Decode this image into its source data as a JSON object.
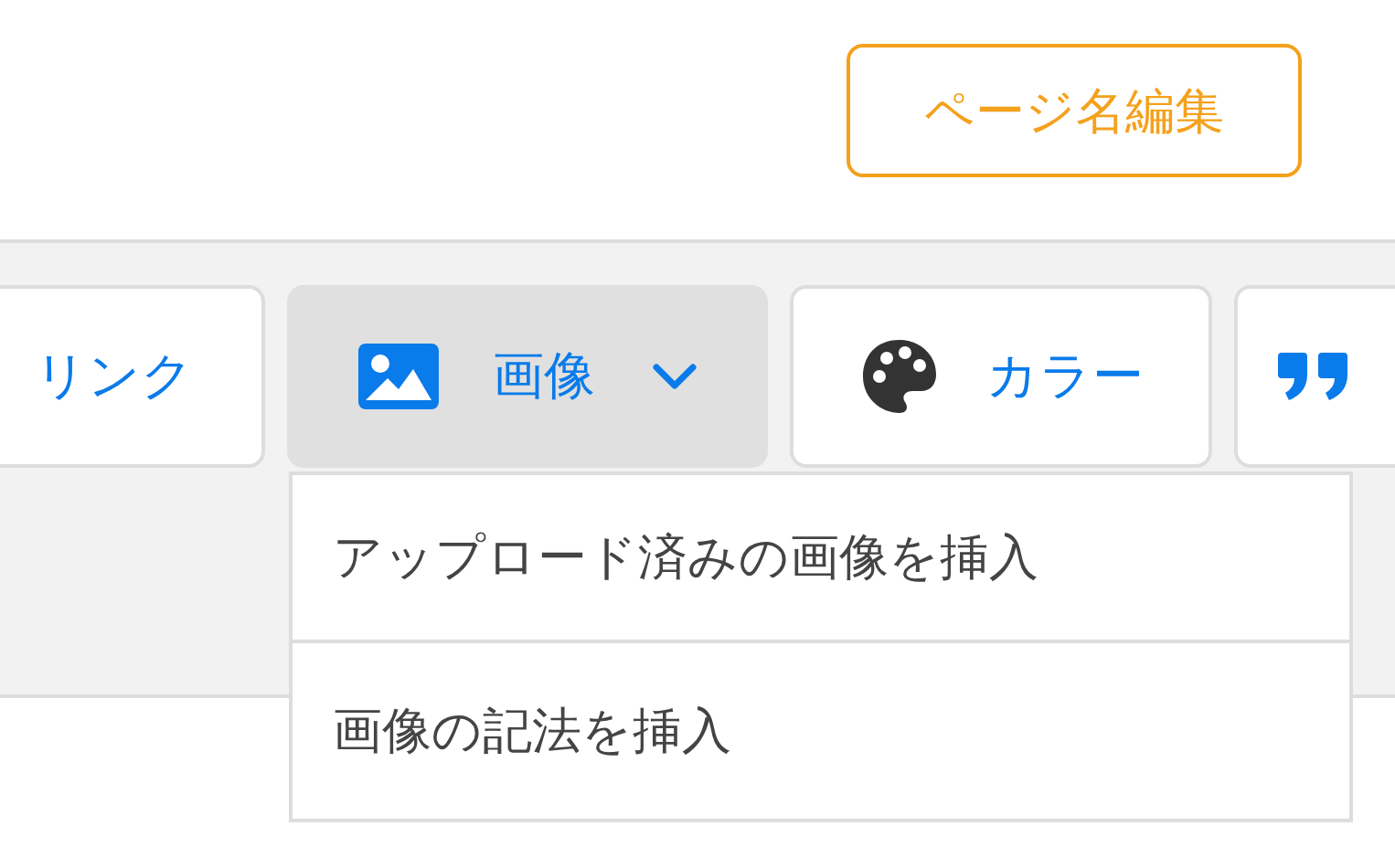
{
  "header": {
    "edit_button": "ページ名編集"
  },
  "toolbar": {
    "buttons": [
      {
        "label": "リンク",
        "kind": "text",
        "selected": false
      },
      {
        "label": "画像",
        "kind": "image",
        "selected": true
      },
      {
        "label": "カラー",
        "kind": "color",
        "selected": false
      },
      {
        "kind": "quote",
        "selected": false
      }
    ]
  },
  "dropdown": {
    "items": [
      {
        "label": "アップロード済みの画像を挿入"
      },
      {
        "label": "画像の記法を挿入"
      }
    ]
  }
}
